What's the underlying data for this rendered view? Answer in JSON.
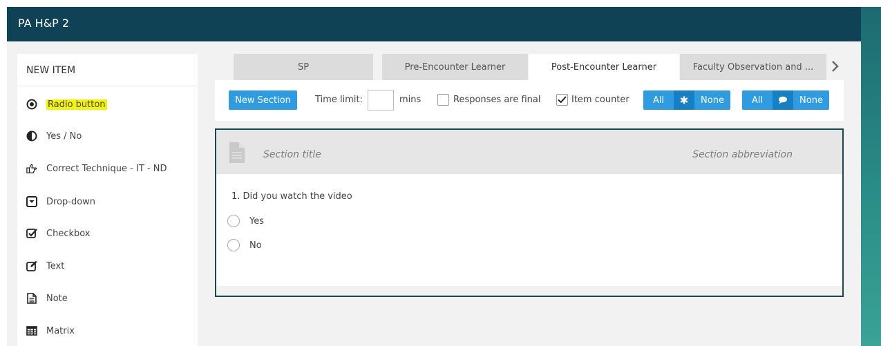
{
  "app": {
    "title": "PA H&P 2"
  },
  "sidebar": {
    "header": "NEW ITEM",
    "items": [
      {
        "label": "Radio button",
        "icon": "radio-button-icon"
      },
      {
        "label": "Yes / No",
        "icon": "half-circle-icon"
      },
      {
        "label": "Correct Technique - IT - ND",
        "icon": "hand-point-icon"
      },
      {
        "label": "Drop-down",
        "icon": "dropdown-icon"
      },
      {
        "label": "Checkbox",
        "icon": "checkbox-icon"
      },
      {
        "label": "Text",
        "icon": "edit-icon"
      },
      {
        "label": "Note",
        "icon": "note-icon"
      },
      {
        "label": "Matrix",
        "icon": "table-icon"
      }
    ]
  },
  "tabs": [
    {
      "label": "SP"
    },
    {
      "label": "Pre-Encounter Learner"
    },
    {
      "label": "Post-Encounter Learner"
    },
    {
      "label": "Faculty Observation and ..."
    }
  ],
  "toolbar": {
    "new_section": "New Section",
    "time_limit_label": "Time limit:",
    "time_limit_value": "",
    "mins": "mins",
    "responses_final": "Responses are final",
    "item_counter": "Item counter",
    "group1_all": "All",
    "group1_none": "None",
    "group2_all": "All",
    "group2_none": "None"
  },
  "section": {
    "title_placeholder": "Section title",
    "abbr_placeholder": "Section abbreviation",
    "question": "1.   Did you watch the video",
    "options": [
      "Yes",
      "No"
    ]
  },
  "colors": {
    "header_bg": "#0f4254",
    "accent_blue": "#2f9be0",
    "highlight_yellow": "#f5f500",
    "section_border": "#1b4553"
  }
}
